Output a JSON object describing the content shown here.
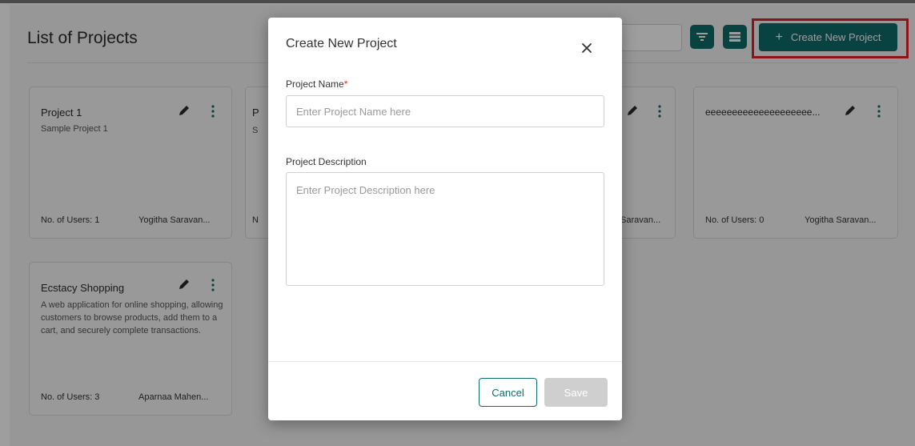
{
  "page": {
    "title": "List of Projects",
    "create_button_label": "Create New Project",
    "create_button_icon": "plus-icon",
    "filter_icon": "filter-icon",
    "list_view_icon": "list-view-icon",
    "accent_color": "#0d6b6a",
    "highlight_color": "#e0202a"
  },
  "projects": [
    {
      "name": "Project 1",
      "description": "Sample Project 1",
      "users_label": "No. of Users:",
      "users_count": "1",
      "owner": "Yogitha Saravan..."
    },
    {
      "name": "P",
      "description": "S",
      "users_label": "N",
      "users_count": "",
      "owner": ""
    },
    {
      "name": "",
      "description": "",
      "users_label": "",
      "users_count": "",
      "owner": "Saravan..."
    },
    {
      "name": "eeeeeeeeeeeeeeeeeeee...",
      "description": "",
      "users_label": "No. of Users:",
      "users_count": "0",
      "owner": "Yogitha Saravan..."
    },
    {
      "name": "Ecstacy Shopping",
      "description": "A web application for online shopping, allowing customers to browse products, add them to a cart, and securely complete transactions.",
      "users_label": "No. of Users:",
      "users_count": "3",
      "owner": "Aparnaa Mahen..."
    }
  ],
  "modal": {
    "title": "Create New Project",
    "close_icon": "close-icon",
    "project_name_label": "Project Name",
    "required_marker": "*",
    "project_name_placeholder": "Enter Project Name here",
    "project_name_value": "",
    "project_description_label": "Project Description",
    "project_description_placeholder": "Enter Project Description here",
    "project_description_value": "",
    "cancel_label": "Cancel",
    "save_label": "Save"
  }
}
